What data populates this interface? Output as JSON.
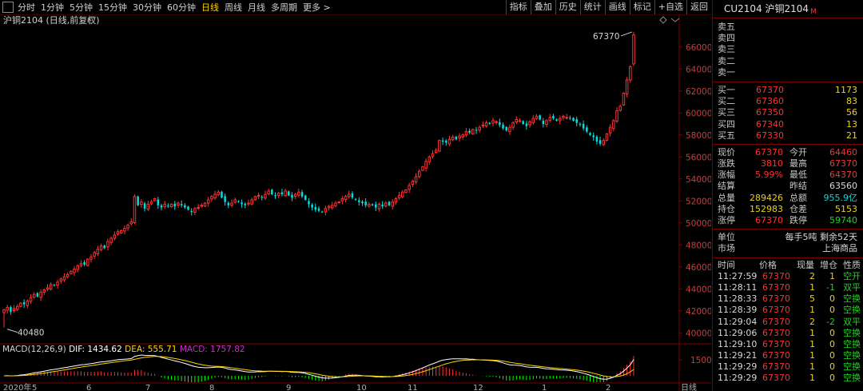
{
  "toolbar": {
    "periods": [
      "分时",
      "1分钟",
      "5分钟",
      "15分钟",
      "30分钟",
      "60分钟",
      "日线",
      "周线",
      "月线",
      "多周期",
      "更多 >"
    ],
    "active_index": 6,
    "right_buttons": [
      "指标",
      "叠加",
      "历史",
      "统计",
      "画线",
      "标记",
      "+自选",
      "返回"
    ]
  },
  "chart_data": {
    "type": "candlestick",
    "title": "沪铜2104 (日线,前复权)",
    "ylim": [
      39000,
      67800
    ],
    "y_ticks": [
      40000,
      42000,
      44000,
      46000,
      48000,
      50000,
      52000,
      54000,
      56000,
      58000,
      60000,
      62000,
      64000,
      66000
    ],
    "annotations": [
      {
        "text": "67370",
        "value": 67370
      },
      {
        "text": "40480",
        "value": 40480
      }
    ],
    "x_labels": [
      "2020年",
      "5",
      "6",
      "7",
      "8",
      "9",
      "10",
      "11",
      "12",
      "1",
      "2",
      "日线"
    ],
    "closes": [
      42100,
      42300,
      41900,
      42200,
      42400,
      42700,
      42600,
      42900,
      43200,
      43500,
      43300,
      43700,
      43900,
      44100,
      44400,
      44300,
      44600,
      44900,
      45100,
      45300,
      45600,
      45800,
      46100,
      46300,
      46200,
      46700,
      46900,
      47300,
      47600,
      47900,
      47700,
      48300,
      48600,
      48900,
      49200,
      49300,
      49500,
      49800,
      50100,
      52400,
      51600,
      51900,
      51300,
      51700,
      51900,
      52200,
      51600,
      51400,
      51700,
      51500,
      51700,
      51500,
      51800,
      51600,
      51400,
      51200,
      51000,
      51300,
      51400,
      51600,
      51800,
      52100,
      52400,
      52600,
      52800,
      52300,
      51900,
      51600,
      51800,
      52100,
      51900,
      51700,
      51600,
      51800,
      52100,
      52400,
      52500,
      52300,
      52600,
      52900,
      52600,
      52500,
      52700,
      52600,
      52900,
      52500,
      52300,
      52600,
      52800,
      52400,
      52100,
      51700,
      51400,
      51200,
      51100,
      51000,
      51300,
      51500,
      51600,
      51800,
      51900,
      52200,
      52400,
      52600,
      52300,
      52100,
      51900,
      51800,
      51600,
      51700,
      51600,
      51400,
      51700,
      51500,
      51800,
      51600,
      51900,
      52200,
      52500,
      52800,
      53000,
      53400,
      53800,
      54200,
      54700,
      55100,
      55600,
      56000,
      56300,
      56600,
      57500,
      57400,
      57300,
      57600,
      57800,
      57600,
      57900,
      58000,
      58300,
      58200,
      58500,
      58400,
      58700,
      58900,
      59100,
      59000,
      59300,
      59200,
      58900,
      58600,
      58400,
      58700,
      59100,
      59400,
      59300,
      59000,
      58800,
      59200,
      59500,
      59700,
      59400,
      59000,
      59300,
      59600,
      59500,
      59300,
      59500,
      59700,
      59600,
      59500,
      59300,
      59100,
      59000,
      58600,
      58300,
      58000,
      57800,
      57400,
      57200,
      57500,
      58100,
      58700,
      59300,
      60200,
      60600,
      61800,
      63000,
      64200,
      67100
    ],
    "volume_series": [
      {
        "name": "DIF",
        "value": "1434.62"
      },
      {
        "name": "DEA",
        "value": "555.71"
      },
      {
        "name": "MACD",
        "value": "1757.82"
      }
    ],
    "macd_label": "MACD(12,26,9)",
    "macd_tick": "1500",
    "colors": {
      "up": "#ff3030",
      "down": "#00e0e0",
      "macd_up": "#ff3030",
      "macd_down": "#00ff00",
      "dif": "#ffffff",
      "dea": "#ffd200",
      "macd_label": "#c830c8"
    }
  },
  "panel": {
    "header": "CU2104 沪铜2104",
    "header_mark": "M",
    "asks": [
      {
        "label": "卖五"
      },
      {
        "label": "卖四"
      },
      {
        "label": "卖三"
      },
      {
        "label": "卖二"
      },
      {
        "label": "卖一"
      }
    ],
    "bids": [
      {
        "label": "买一",
        "price": "67370",
        "vol": "1173"
      },
      {
        "label": "买二",
        "price": "67360",
        "vol": "83"
      },
      {
        "label": "买三",
        "price": "67350",
        "vol": "56"
      },
      {
        "label": "买四",
        "price": "67340",
        "vol": "13"
      },
      {
        "label": "买五",
        "price": "67330",
        "vol": "21"
      }
    ],
    "quote": [
      {
        "l1": "现价",
        "v1": "67370",
        "c1": "red",
        "l2": "今开",
        "v2": "64460",
        "c2": "red"
      },
      {
        "l1": "涨跌",
        "v1": "3810",
        "c1": "red",
        "l2": "最高",
        "v2": "67370",
        "c2": "red"
      },
      {
        "l1": "涨幅",
        "v1": "5.99%",
        "c1": "red",
        "l2": "最低",
        "v2": "64370",
        "c2": "red"
      },
      {
        "l1": "结算",
        "v1": "",
        "c1": "white",
        "l2": "昨结",
        "v2": "63560",
        "c2": "white"
      },
      {
        "l1": "总量",
        "v1": "289426",
        "c1": "yellow",
        "l2": "总额",
        "v2": "955.9亿",
        "c2": "cyan"
      },
      {
        "l1": "持仓",
        "v1": "152983",
        "c1": "yellow",
        "l2": "仓差",
        "v2": "5153",
        "c2": "yellow"
      },
      {
        "l1": "涨停",
        "v1": "67370",
        "c1": "red",
        "l2": "跌停",
        "v2": "59740",
        "c2": "green"
      }
    ],
    "info": [
      {
        "label": "单位",
        "value": "每手5吨  剩余52天"
      },
      {
        "label": "市场",
        "value": "上海商品"
      }
    ],
    "trade_headers": [
      "时间",
      "价格",
      "现量",
      "增仓",
      "性质"
    ],
    "trades": [
      {
        "time": "11:27:59",
        "price": "67370",
        "vol": "2",
        "oi": "1",
        "type": "空开",
        "tc": "green"
      },
      {
        "time": "11:28:11",
        "price": "67370",
        "vol": "1",
        "oi": "-1",
        "type": "双平",
        "tc": "green"
      },
      {
        "time": "11:28:33",
        "price": "67370",
        "vol": "5",
        "oi": "0",
        "type": "空换",
        "tc": "green"
      },
      {
        "time": "11:28:39",
        "price": "67370",
        "vol": "1",
        "oi": "0",
        "type": "空换",
        "tc": "green"
      },
      {
        "time": "11:29:04",
        "price": "67370",
        "vol": "2",
        "oi": "-2",
        "type": "双平",
        "tc": "green"
      },
      {
        "time": "11:29:06",
        "price": "67370",
        "vol": "1",
        "oi": "0",
        "type": "空换",
        "tc": "green"
      },
      {
        "time": "11:29:10",
        "price": "67370",
        "vol": "1",
        "oi": "0",
        "type": "空换",
        "tc": "green"
      },
      {
        "time": "11:29:21",
        "price": "67370",
        "vol": "1",
        "oi": "0",
        "type": "空换",
        "tc": "green"
      },
      {
        "time": "11:29:29",
        "price": "67370",
        "vol": "1",
        "oi": "0",
        "type": "空换",
        "tc": "green"
      },
      {
        "time": "11:29:29",
        "price": "67370",
        "vol": "1",
        "oi": "0",
        "type": "空换",
        "tc": "green"
      }
    ]
  }
}
